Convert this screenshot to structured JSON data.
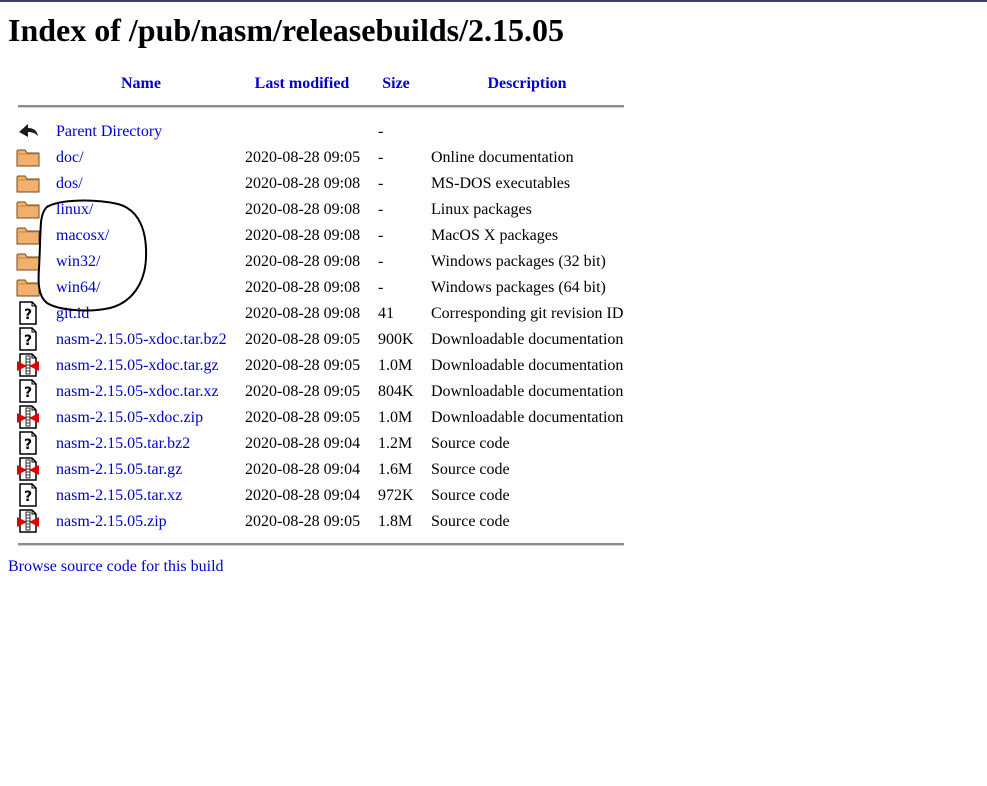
{
  "page": {
    "title": "Index of /pub/nasm/releasebuilds/2.15.05"
  },
  "table": {
    "headers": {
      "name": "Name",
      "last_modified": "Last modified",
      "size": "Size",
      "description": "Description"
    },
    "rows": [
      {
        "icon": "back-icon",
        "name": "Parent Directory",
        "date": "",
        "size": "-",
        "desc": ""
      },
      {
        "icon": "folder-icon",
        "name": "doc/",
        "date": "2020-08-28 09:05",
        "size": "-",
        "desc": "Online documentation"
      },
      {
        "icon": "folder-icon",
        "name": "dos/",
        "date": "2020-08-28 09:08",
        "size": "-",
        "desc": "MS-DOS executables"
      },
      {
        "icon": "folder-icon",
        "name": "linux/",
        "date": "2020-08-28 09:08",
        "size": "-",
        "desc": "Linux packages"
      },
      {
        "icon": "folder-icon",
        "name": "macosx/",
        "date": "2020-08-28 09:08",
        "size": "-",
        "desc": "MacOS X packages"
      },
      {
        "icon": "folder-icon",
        "name": "win32/",
        "date": "2020-08-28 09:08",
        "size": "-",
        "desc": "Windows packages (32 bit)"
      },
      {
        "icon": "folder-icon",
        "name": "win64/",
        "date": "2020-08-28 09:08",
        "size": "-",
        "desc": "Windows packages (64 bit)"
      },
      {
        "icon": "unknown-file-icon",
        "name": "git.id",
        "date": "2020-08-28 09:08",
        "size": "41",
        "desc": "Corresponding git revision ID"
      },
      {
        "icon": "unknown-file-icon",
        "name": "nasm-2.15.05-xdoc.tar.bz2",
        "date": "2020-08-28 09:05",
        "size": "900K",
        "desc": "Downloadable documentation"
      },
      {
        "icon": "compressed-file-icon",
        "name": "nasm-2.15.05-xdoc.tar.gz",
        "date": "2020-08-28 09:05",
        "size": "1.0M",
        "desc": "Downloadable documentation"
      },
      {
        "icon": "unknown-file-icon",
        "name": "nasm-2.15.05-xdoc.tar.xz",
        "date": "2020-08-28 09:05",
        "size": "804K",
        "desc": "Downloadable documentation"
      },
      {
        "icon": "compressed-file-icon",
        "name": "nasm-2.15.05-xdoc.zip",
        "date": "2020-08-28 09:05",
        "size": "1.0M",
        "desc": "Downloadable documentation"
      },
      {
        "icon": "unknown-file-icon",
        "name": "nasm-2.15.05.tar.bz2",
        "date": "2020-08-28 09:04",
        "size": "1.2M",
        "desc": "Source code"
      },
      {
        "icon": "compressed-file-icon",
        "name": "nasm-2.15.05.tar.gz",
        "date": "2020-08-28 09:04",
        "size": "1.6M",
        "desc": "Source code"
      },
      {
        "icon": "unknown-file-icon",
        "name": "nasm-2.15.05.tar.xz",
        "date": "2020-08-28 09:04",
        "size": "972K",
        "desc": "Source code"
      },
      {
        "icon": "compressed-file-icon",
        "name": "nasm-2.15.05.zip",
        "date": "2020-08-28 09:05",
        "size": "1.8M",
        "desc": "Source code"
      }
    ]
  },
  "footer": {
    "link": "Browse source code for this build"
  },
  "colors": {
    "link": "#0000cc",
    "annotation": "#000000"
  }
}
